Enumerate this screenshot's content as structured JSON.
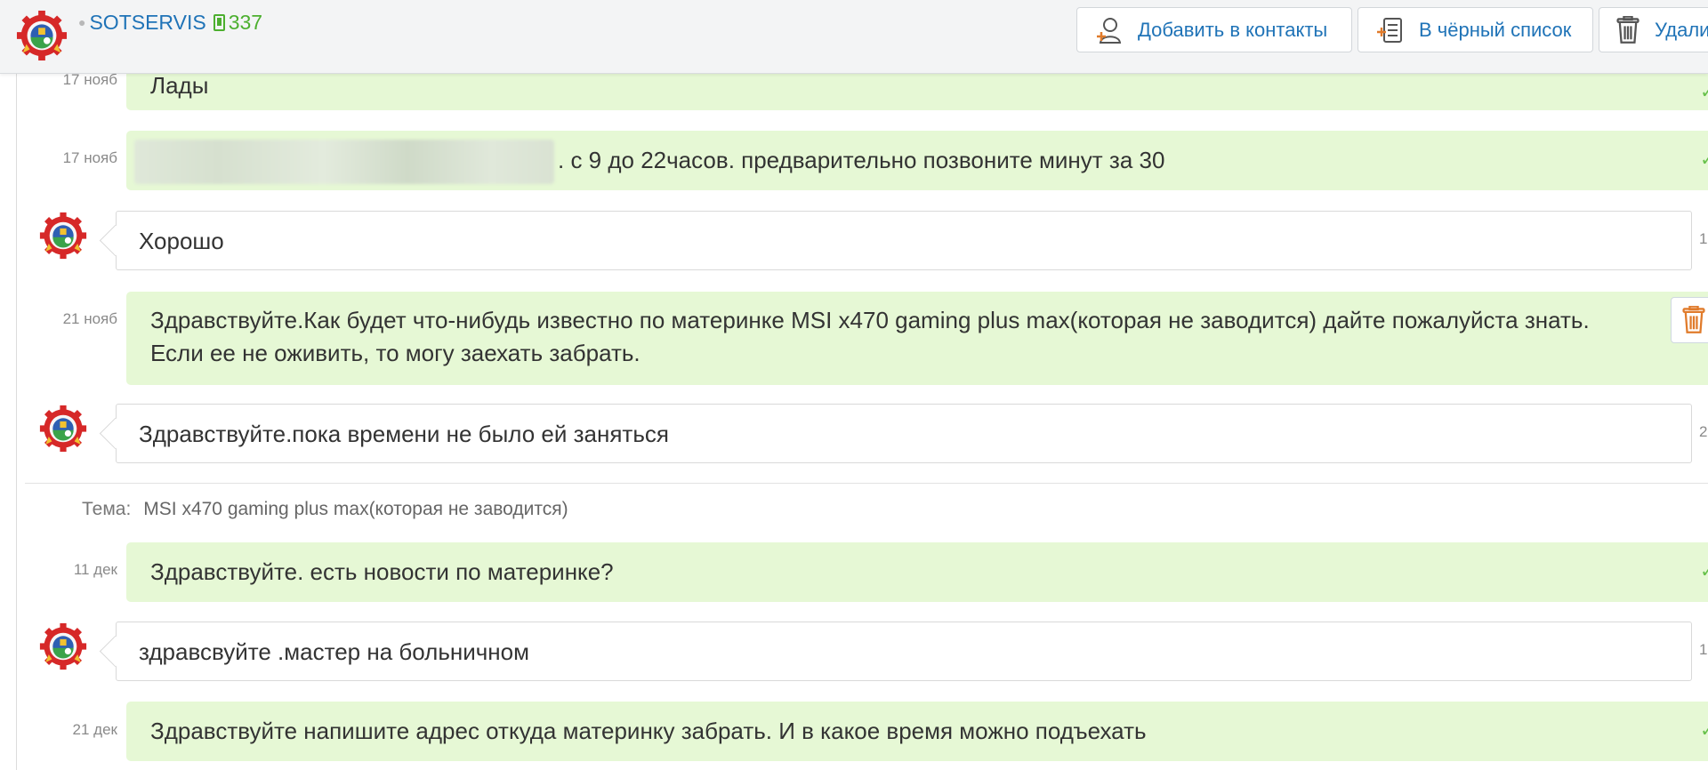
{
  "header": {
    "user_name": "SOTSERVIS",
    "rating": "337",
    "buttons": {
      "add_contact": "Добавить в контакты",
      "blacklist": "В чёрный список",
      "delete": "Удалить"
    }
  },
  "messages": [
    {
      "dir": "out",
      "date": "17 нояб",
      "text": "Лады"
    },
    {
      "dir": "out",
      "date": "17 нояб",
      "text": ". с 9 до 22часов. предварительно позвоните минут за 30"
    },
    {
      "dir": "in",
      "text": "Хорошо",
      "time_fragment": "1"
    },
    {
      "dir": "out",
      "date": "21 нояб",
      "text_line1": "Здравствуйте.Как будет что-нибудь известно по материнке MSI x470 gaming plus max(которая не заводится) дайте пожалуйста знать.",
      "text_line2": "Если ее не оживить, то могу заехать забрать."
    },
    {
      "dir": "in",
      "text": "Здравствуйте.пока времени не было ей заняться",
      "time_fragment": "2"
    },
    {
      "dir": "out",
      "date": "11 дек",
      "text": "Здравствуйте. есть новости по материнке?"
    },
    {
      "dir": "in",
      "text": "здравсвуйте .мастер на больничном",
      "time_fragment": "1"
    },
    {
      "dir": "out",
      "date": "21 дек",
      "text": "Здравствуйте напишите адрес откуда материнку забрать. И в какое время можно подъехать"
    }
  ],
  "topic": {
    "label": "Тема:",
    "value": "MSI x470 gaming plus max(которая не заводится)"
  },
  "colors": {
    "accent": "#1f73b7",
    "rating_green": "#4caf2f",
    "outgoing_bubble": "#e6f8d5",
    "check": "#66c04a"
  },
  "icons": [
    "logo-gear-emblem",
    "add-contact-icon",
    "blacklist-icon",
    "trash-icon",
    "check-icon",
    "phone-icon"
  ]
}
